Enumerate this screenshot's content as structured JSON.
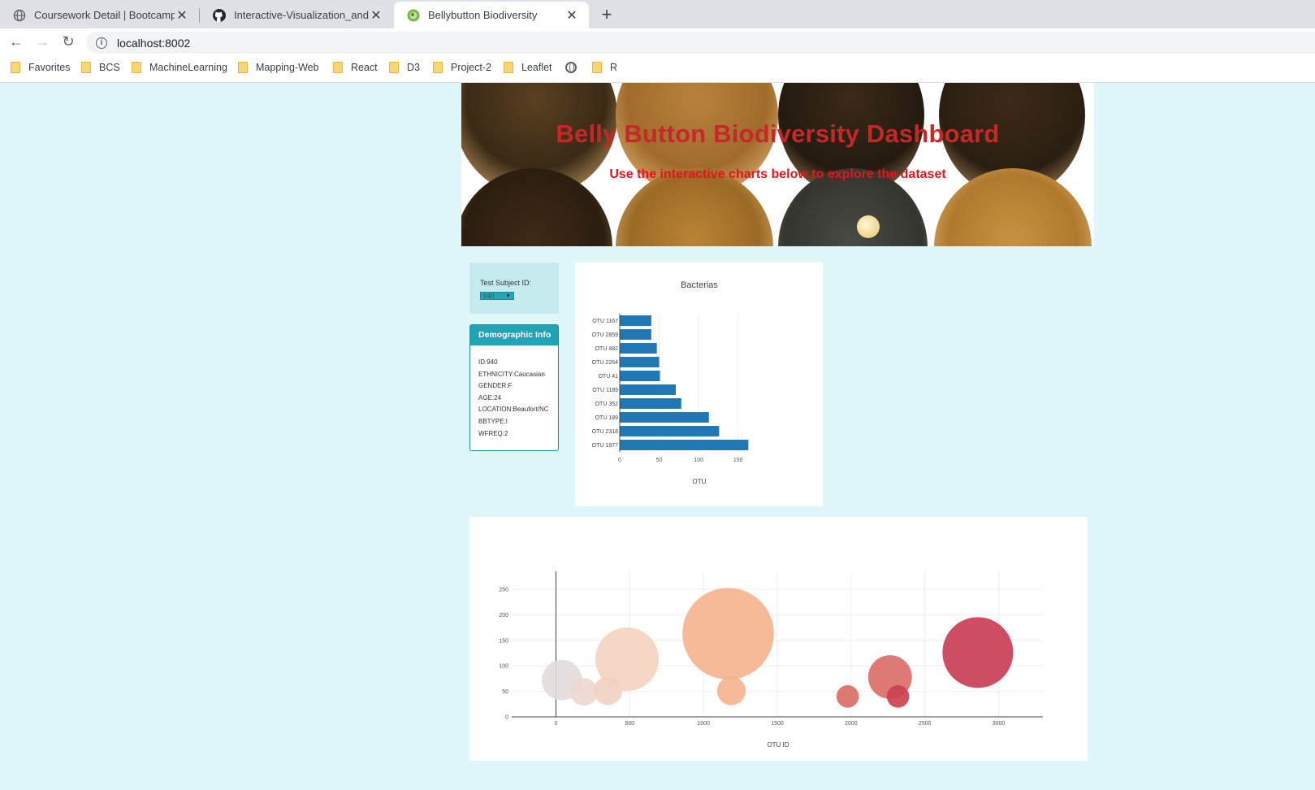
{
  "browser": {
    "tabs": [
      {
        "title": "Coursework Detail | Bootcamp Sp",
        "icon": "globe-icon"
      },
      {
        "title": "Interactive-Visualization_and_Das",
        "icon": "github-icon"
      },
      {
        "title": "Bellybutton Biodiversity",
        "icon": "leaf-favicon",
        "active": true
      }
    ],
    "close_glyph": "✕",
    "new_tab_glyph": "+",
    "url": "localhost:8002",
    "bookmarks": [
      "Favorites",
      "BCS",
      "MachineLearning",
      "Mapping-Web",
      "React",
      "D3",
      "Project-2",
      "Leaflet",
      "",
      "R"
    ]
  },
  "header": {
    "title": "Belly Button Biodiversity Dashboard",
    "subtitle": "Use the interactive charts below to explore the dataset"
  },
  "selector": {
    "label": "Test Subject ID:",
    "value": "940",
    "arrow": "▼"
  },
  "demographics": {
    "heading": "Demographic Info",
    "lines": [
      "ID:940",
      "ETHNICITY:Caucasian",
      "GENDER:F",
      "AGE:24",
      "LOCATION:Beaufort/NC",
      "BBTYPE:I",
      "WFREQ:2"
    ]
  },
  "colors": {
    "bar": "#1f77b4",
    "title_red": "#c62828",
    "subtitle_red": "#e3151c",
    "panel_teal": "#1fa3b5"
  },
  "chart_data": [
    {
      "type": "bar",
      "orientation": "horizontal",
      "title": "Bacterias",
      "xlabel": "OTU",
      "ylabel": "",
      "categories": [
        "OTU 1167",
        "OTU 2859",
        "OTU 482",
        "OTU 2264",
        "OTU 41",
        "OTU 1189",
        "OTU 352",
        "OTU 189",
        "OTU 2318",
        "OTU 1977"
      ],
      "values": [
        40,
        40,
        47,
        50,
        51,
        71,
        78,
        113,
        126,
        163
      ],
      "xlim": [
        0,
        175
      ],
      "xticks": [
        0,
        50,
        100,
        150
      ],
      "grid": true
    },
    {
      "type": "scatter",
      "style": "bubble",
      "title": "",
      "xlabel": "OTU ID",
      "ylabel": "",
      "xlim": [
        -300,
        3300
      ],
      "ylim": [
        0,
        285
      ],
      "xticks": [
        0,
        500,
        1000,
        1500,
        2000,
        2500,
        3000
      ],
      "yticks": [
        0,
        50,
        100,
        150,
        200,
        250
      ],
      "grid": true,
      "points": [
        {
          "x": 41,
          "y": 72,
          "size": 72,
          "color": "#e2dcdc"
        },
        {
          "x": 189,
          "y": 49,
          "size": 49,
          "color": "#ecd7cf"
        },
        {
          "x": 352,
          "y": 51,
          "size": 51,
          "color": "#f0d2c2"
        },
        {
          "x": 482,
          "y": 113,
          "size": 113,
          "color": "#f3d3bf"
        },
        {
          "x": 1167,
          "y": 163,
          "size": 163,
          "color": "#f5b28d"
        },
        {
          "x": 1189,
          "y": 51,
          "size": 51,
          "color": "#f5b28d"
        },
        {
          "x": 1977,
          "y": 40,
          "size": 40,
          "color": "#d86a60"
        },
        {
          "x": 2264,
          "y": 78,
          "size": 78,
          "color": "#d96b66"
        },
        {
          "x": 2318,
          "y": 40,
          "size": 40,
          "color": "#c9404c"
        },
        {
          "x": 2859,
          "y": 126,
          "size": 126,
          "color": "#c83b52"
        }
      ]
    }
  ]
}
